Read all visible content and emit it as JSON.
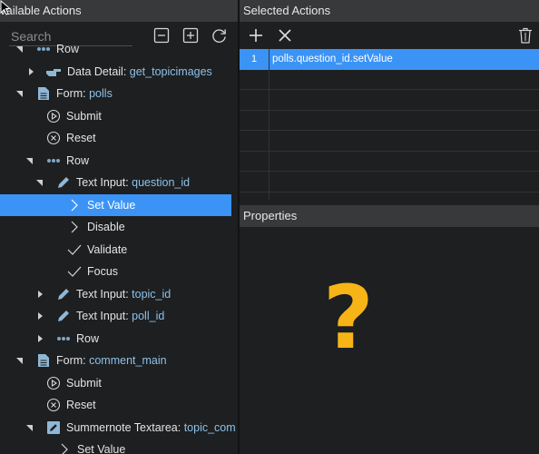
{
  "left_panel": {
    "title": "vailable Actions",
    "search_placeholder": "Search",
    "tree": [
      {
        "text": "Row",
        "value": ""
      },
      {
        "text": "Data Detail: ",
        "value": "get_topicimages"
      },
      {
        "text": "Form: ",
        "value": "polls"
      },
      {
        "text": "Submit",
        "value": ""
      },
      {
        "text": "Reset",
        "value": ""
      },
      {
        "text": "Row",
        "value": ""
      },
      {
        "text": "Text Input: ",
        "value": "question_id"
      },
      {
        "text": "Set Value",
        "value": ""
      },
      {
        "text": "Disable",
        "value": ""
      },
      {
        "text": "Validate",
        "value": ""
      },
      {
        "text": "Focus",
        "value": ""
      },
      {
        "text": "Text Input: ",
        "value": "topic_id"
      },
      {
        "text": "Text Input: ",
        "value": "poll_id"
      },
      {
        "text": "Row",
        "value": ""
      },
      {
        "text": "Form: ",
        "value": "comment_main"
      },
      {
        "text": "Submit",
        "value": ""
      },
      {
        "text": "Reset",
        "value": ""
      },
      {
        "text": "Summernote Textarea: ",
        "value": "topic_com"
      },
      {
        "text": "Set Value",
        "value": ""
      }
    ]
  },
  "right_panel": {
    "title": "Selected Actions",
    "actions": [
      {
        "num": "1",
        "text": "polls.question_id.setValue"
      }
    ],
    "properties_title": "Properties",
    "properties_placeholder": "?"
  },
  "colors": {
    "accent": "#3b93f5",
    "value_text": "#8ec1e8",
    "question_mark": "#f7b417"
  }
}
